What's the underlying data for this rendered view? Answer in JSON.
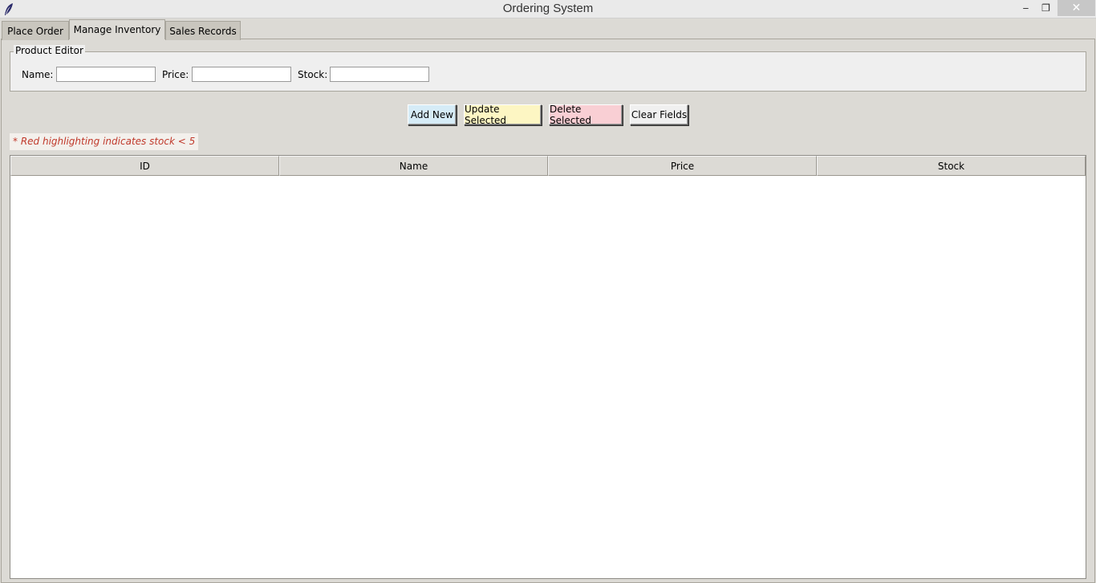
{
  "window": {
    "title": "Ordering System",
    "minimize_glyph": "‒",
    "maximize_glyph": "❐",
    "close_glyph": "✕",
    "icon": "feather-icon"
  },
  "tabs": [
    {
      "label": "Place Order"
    },
    {
      "label": "Manage Inventory"
    },
    {
      "label": "Sales Records"
    }
  ],
  "product_editor": {
    "title": "Product Editor",
    "name_label": "Name:",
    "name_value": "",
    "price_label": "Price:",
    "price_value": "",
    "stock_label": "Stock:",
    "stock_value": ""
  },
  "buttons": {
    "add": {
      "label": "Add New",
      "color": "#d6ecf7"
    },
    "update": {
      "label": "Update Selected",
      "color": "#fdf6c3"
    },
    "delete": {
      "label": "Delete Selected",
      "color": "#f9cfd4"
    },
    "clear": {
      "label": "Clear Fields",
      "color": "#f0f0f0"
    }
  },
  "note": {
    "text": "* Red highlighting indicates stock < 5",
    "color": "#c0392b",
    "background": "#f3f0ec"
  },
  "table": {
    "columns": [
      "ID",
      "Name",
      "Price",
      "Stock"
    ],
    "rows": []
  }
}
